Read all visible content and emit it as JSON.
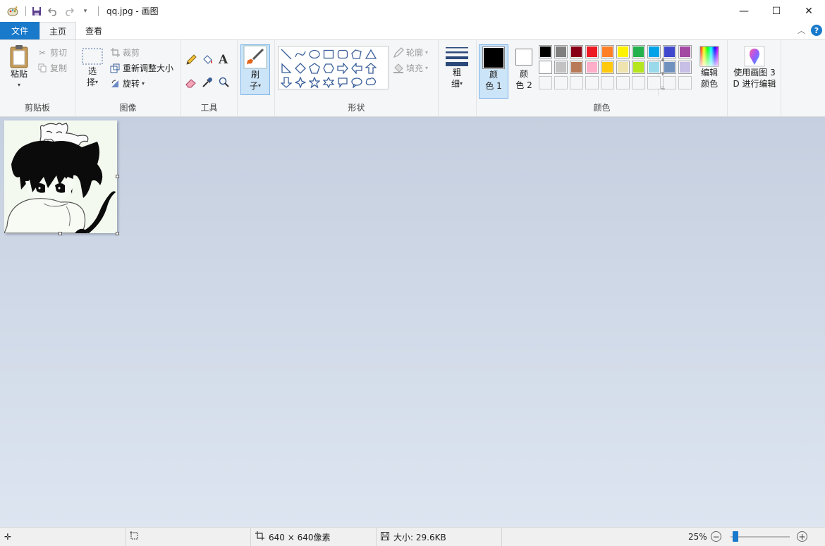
{
  "window": {
    "title": "qq.jpg - 画图",
    "minimize": "—",
    "maximize": "☐",
    "close": "✕"
  },
  "tabs": {
    "file": "文件",
    "home": "主页",
    "view": "查看"
  },
  "ribbon": {
    "clipboard": {
      "label": "剪贴板",
      "paste": "粘贴",
      "cut": "剪切",
      "copy": "复制"
    },
    "image": {
      "label": "图像",
      "select_line1": "选",
      "select_line2": "择",
      "crop": "裁剪",
      "resize": "重新调整大小",
      "rotate": "旋转"
    },
    "tools": {
      "label": "工具",
      "text_glyph": "A"
    },
    "brushes": {
      "line1": "刷",
      "line2": "子"
    },
    "shapes": {
      "label": "形状",
      "outline": "轮廓",
      "fill": "填充"
    },
    "size": {
      "line1": "粗",
      "line2": "细"
    },
    "colors": {
      "label": "颜色",
      "color1_line1": "颜",
      "color1_line2": "色 1",
      "color2_line1": "颜",
      "color2_line2": "色 2",
      "edit_line1": "编辑",
      "edit_line2": "颜色",
      "color1": "#000000",
      "color2": "#ffffff",
      "palette_row1": [
        "#000000",
        "#7f7f7f",
        "#880015",
        "#ed1c24",
        "#ff7f27",
        "#fff200",
        "#22b14c",
        "#00a2e8",
        "#3f48cc",
        "#a349a4"
      ],
      "palette_row2": [
        "#ffffff",
        "#c3c3c3",
        "#b97a57",
        "#ffaec9",
        "#ffc90e",
        "#efe4b0",
        "#b5e61d",
        "#99d9ea",
        "#7092be",
        "#c8bfe7"
      ],
      "palette_row3": [
        "#f5f6f7",
        "#f5f6f7",
        "#f5f6f7",
        "#f5f6f7",
        "#f5f6f7",
        "#f5f6f7",
        "#f5f6f7",
        "#f5f6f7",
        "#f5f6f7",
        "#f5f6f7"
      ]
    },
    "paint3d": {
      "line1": "使用画图 3",
      "line2": "D 进行编辑"
    }
  },
  "status": {
    "image_size": "640 × 640像素",
    "file_size": "大小: 29.6KB",
    "zoom": "25%",
    "zoom_level": 0.25
  }
}
